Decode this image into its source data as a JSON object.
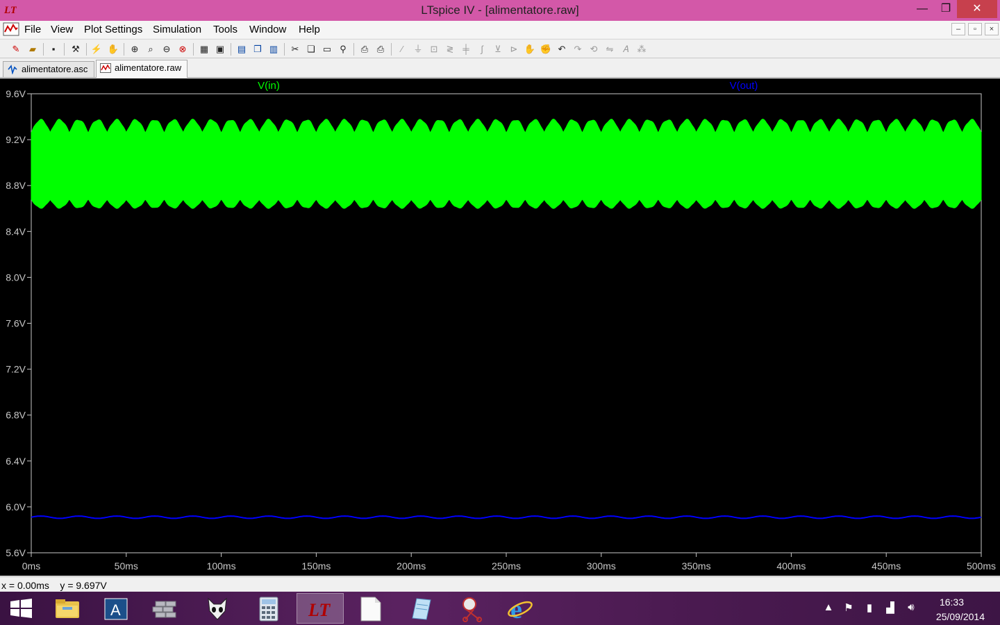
{
  "window": {
    "title": "LTspice IV - [alimentatore.raw]",
    "minimize_glyph": "—",
    "maximize_glyph": "❐",
    "close_glyph": "✕"
  },
  "menu": {
    "items": [
      "File",
      "View",
      "Plot Settings",
      "Simulation",
      "Tools",
      "Window",
      "Help"
    ],
    "mdi_minimize": "–",
    "mdi_restore": "▫",
    "mdi_close": "×"
  },
  "tabs": [
    {
      "label": "alimentatore.asc",
      "icon": "schematic-icon"
    },
    {
      "label": "alimentatore.raw",
      "icon": "waveform-icon"
    }
  ],
  "chart_data": {
    "type": "line",
    "xlabel": "",
    "ylabel": "",
    "x_ticks": [
      "0ms",
      "50ms",
      "100ms",
      "150ms",
      "200ms",
      "250ms",
      "300ms",
      "350ms",
      "400ms",
      "450ms",
      "500ms"
    ],
    "y_ticks": [
      "9.6V",
      "9.2V",
      "8.8V",
      "8.4V",
      "8.0V",
      "7.6V",
      "7.2V",
      "6.8V",
      "6.4V",
      "6.0V",
      "5.6V"
    ],
    "xlim": [
      0,
      500
    ],
    "ylim": [
      5.6,
      9.6
    ],
    "x_unit": "ms",
    "y_unit": "V",
    "grid": false,
    "series": [
      {
        "name": "V(in)",
        "color": "#00ff00",
        "kind": "band",
        "upper_min": 9.2,
        "upper_max": 9.38,
        "lower_min": 8.6,
        "lower_max": 8.72,
        "ripple_cycles": 50
      },
      {
        "name": "V(out)",
        "color": "#0000ff",
        "kind": "line",
        "mean": 5.91,
        "ripple": 0.01,
        "ripple_cycles": 25
      }
    ]
  },
  "status": {
    "cursor_readout": "x = 0.00ms    y = 9.697V"
  },
  "taskbar": {
    "apps": [
      "start-button",
      "file-explorer-icon",
      "autocad-icon",
      "firewall-icon",
      "foobar-icon",
      "calculator-icon",
      "ltspice-icon",
      "document-icon",
      "notepad-icon",
      "snipping-tool-icon",
      "internet-explorer-icon"
    ],
    "active_app": "ltspice-icon",
    "time": "16:33",
    "date": "25/09/2014"
  }
}
